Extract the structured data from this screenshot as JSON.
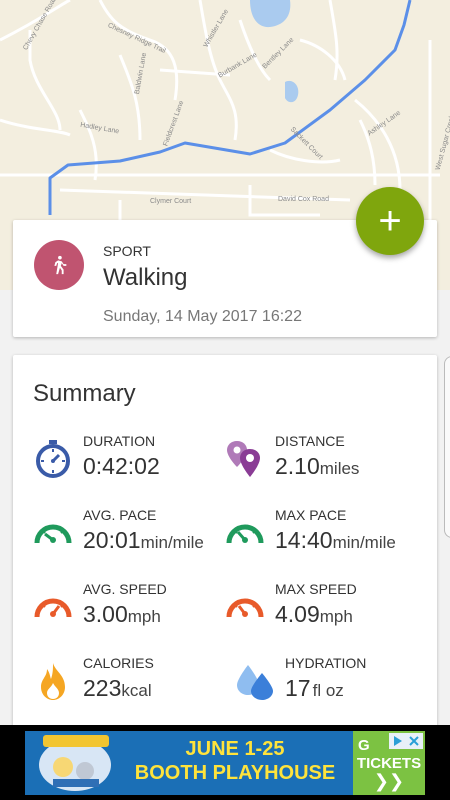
{
  "map": {
    "streets": [
      "Chevy Chase Road",
      "Chesney Ridge Trail",
      "Whistler Lane",
      "Burbank Lane",
      "Baldwin Lane",
      "Bentley Lane",
      "David Cox Road",
      "Clymer Court",
      "Hadley Lane",
      "Ashley Lane",
      "West Sugar Creek Road",
      "Sackett Court",
      "Fieldcrest Lane"
    ]
  },
  "fab": {
    "label": "+"
  },
  "sport": {
    "label": "SPORT",
    "name": "Walking",
    "date": "Sunday, 14 May 2017 16:22",
    "color": "#c05470"
  },
  "summary": {
    "title": "Summary",
    "duration": {
      "label": "DURATION",
      "value": "0:42:02",
      "unit": ""
    },
    "distance": {
      "label": "DISTANCE",
      "value": "2.10",
      "unit": "miles"
    },
    "avg_pace": {
      "label": "AVG. PACE",
      "value": "20:01",
      "unit": "min/mile"
    },
    "max_pace": {
      "label": "MAX PACE",
      "value": "14:40",
      "unit": "min/mile"
    },
    "avg_speed": {
      "label": "AVG. SPEED",
      "value": "3.00",
      "unit": "mph"
    },
    "max_speed": {
      "label": "MAX SPEED",
      "value": "4.09",
      "unit": "mph"
    },
    "calories": {
      "label": "CALORIES",
      "value": "223",
      "unit": "kcal"
    },
    "hydration": {
      "label": "HYDRATION",
      "value": "17",
      "unit": "fl oz"
    }
  },
  "ad": {
    "dates": "JUNE 1-25",
    "venue": "BOOTH PLAYHOUSE",
    "cta": "TICKETS",
    "cta_prefix": "G"
  },
  "colors": {
    "accent": "#7fa60d",
    "route": "#5b8fe8",
    "pace": "#1f9a5c",
    "speed": "#e85a2a",
    "duration": "#3a5ba8",
    "distance": "#8a3c95",
    "calories": "#f5a623",
    "hydration": "#4a90e2"
  }
}
